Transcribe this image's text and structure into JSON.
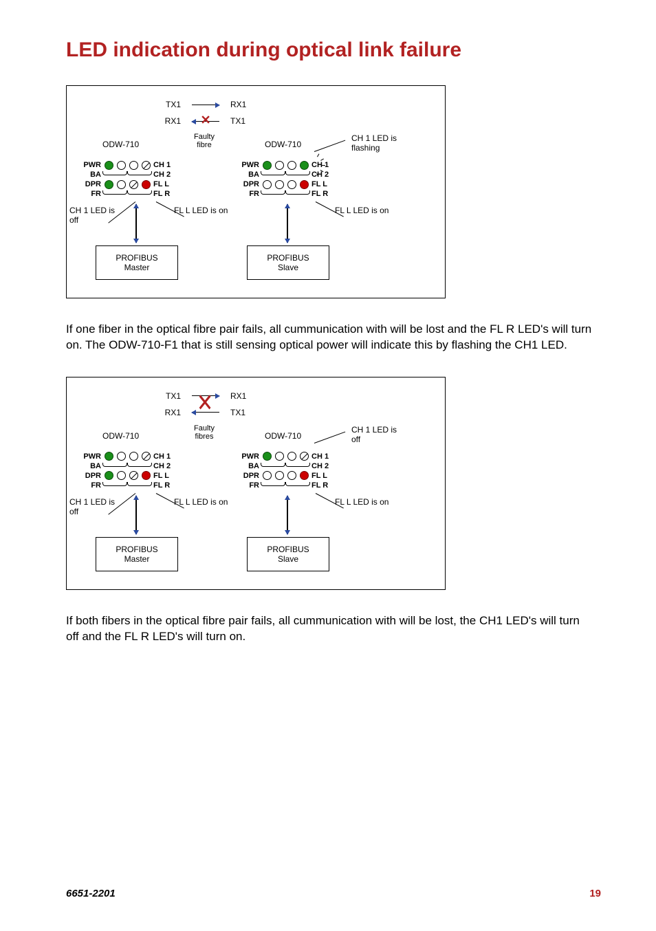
{
  "title": "LED indication during optical link failure",
  "diagram1": {
    "tx1": "TX1",
    "rx1": "RX1",
    "rx1_b": "RX1",
    "tx1_b": "TX1",
    "dev": "ODW-710",
    "fault_label": "Faulty fibre",
    "side_note": "CH 1 LED is flashing",
    "leds": {
      "pwr": "PWR",
      "ba": "BA",
      "dpr": "DPR",
      "fr": "FR",
      "ch1": "CH 1",
      "ch2": "CH 2",
      "fll": "FL L",
      "flr": "FL R"
    },
    "note_left_ch1": "CH 1 LED is off",
    "note_fll": "FL L LED is on",
    "note_fll2": "FL L LED is on",
    "master": {
      "l1": "PROFIBUS",
      "l2": "Master"
    },
    "slave": {
      "l1": "PROFIBUS",
      "l2": "Slave"
    }
  },
  "para1": "If one fiber in the optical fibre pair fails, all cummunication with will be lost and the FL R LED's will turn on. The ODW-710-F1 that is still sensing optical power will indicate this by flashing the CH1 LED.",
  "diagram2": {
    "tx1": "TX1",
    "rx1": "RX1",
    "rx1_b": "RX1",
    "tx1_b": "TX1",
    "dev": "ODW-710",
    "fault_label": "Faulty fibres",
    "side_note": "CH 1 LED is off",
    "note_left_ch1": "CH 1 LED is off",
    "note_fll": "FL L LED is on",
    "note_fll2": "FL L LED is on",
    "master": {
      "l1": "PROFIBUS",
      "l2": "Master"
    },
    "slave": {
      "l1": "PROFIBUS",
      "l2": "Slave"
    }
  },
  "para2": "If both fibers in the optical fibre pair fails, all cummunication with will be lost, the CH1 LED's will turn off and the FL R LED's will turn on.",
  "footer": {
    "doc": "6651-2201",
    "page": "19"
  }
}
